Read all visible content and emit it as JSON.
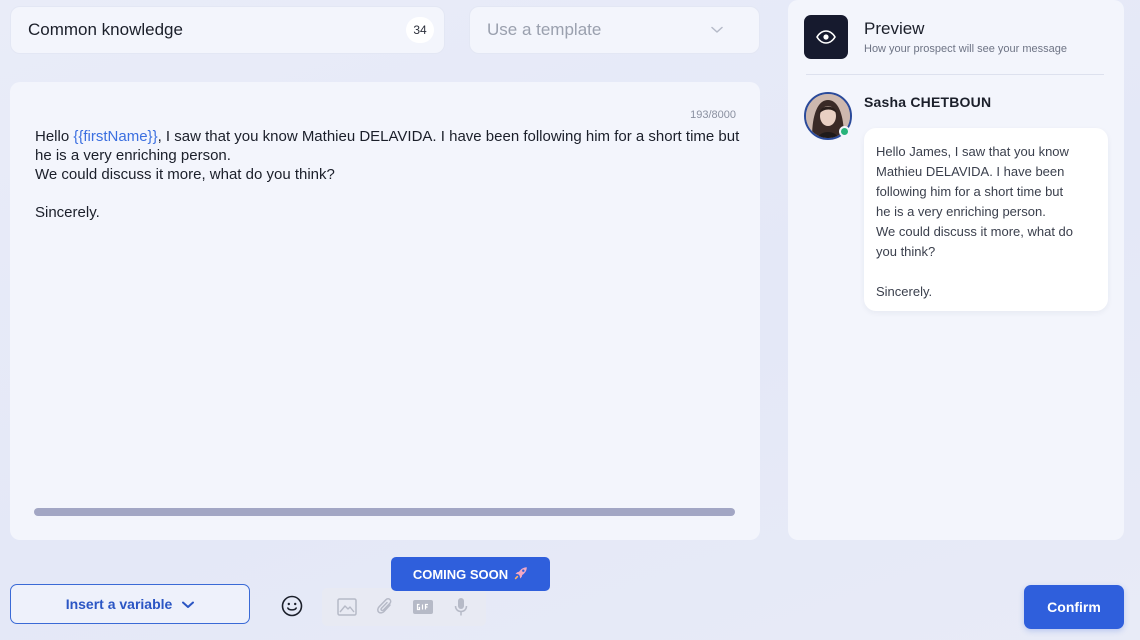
{
  "name_field": {
    "value": "Common knowledge",
    "count": "34"
  },
  "template_select": {
    "placeholder": "Use a template",
    "icon": "chevron-down-icon"
  },
  "editor": {
    "char_counter": "193/8000",
    "message": {
      "greeting": "Hello ",
      "variable": "{{firstName}}",
      "after_variable": ", I saw that you know Mathieu DELAVIDA. I have been following him for a short time but he is a very enriching person.",
      "line_2": "We could discuss it more, what do you think?",
      "sign_off": "Sincerely."
    }
  },
  "preview": {
    "title": "Preview",
    "subtitle": "How your prospect will see your message",
    "icon": "eye-icon",
    "sender_name": "Sasha CHETBOUN",
    "bubble_lines": [
      "Hello James, I saw that you know",
      "Mathieu DELAVIDA. I have been",
      "following him for a short time but",
      "he is a very enriching person.",
      "We could discuss it more, what do",
      "you think?"
    ],
    "bubble_sign_off": "Sincerely."
  },
  "toolbar": {
    "insert_variable_label": "Insert a variable",
    "coming_soon_label": "COMING SOON",
    "confirm_label": "Confirm"
  },
  "colors": {
    "primary": "#2f5fdc",
    "variable_text": "#3b6fe0",
    "online": "#27b37a",
    "dark_icon_bg": "#161a2e"
  }
}
